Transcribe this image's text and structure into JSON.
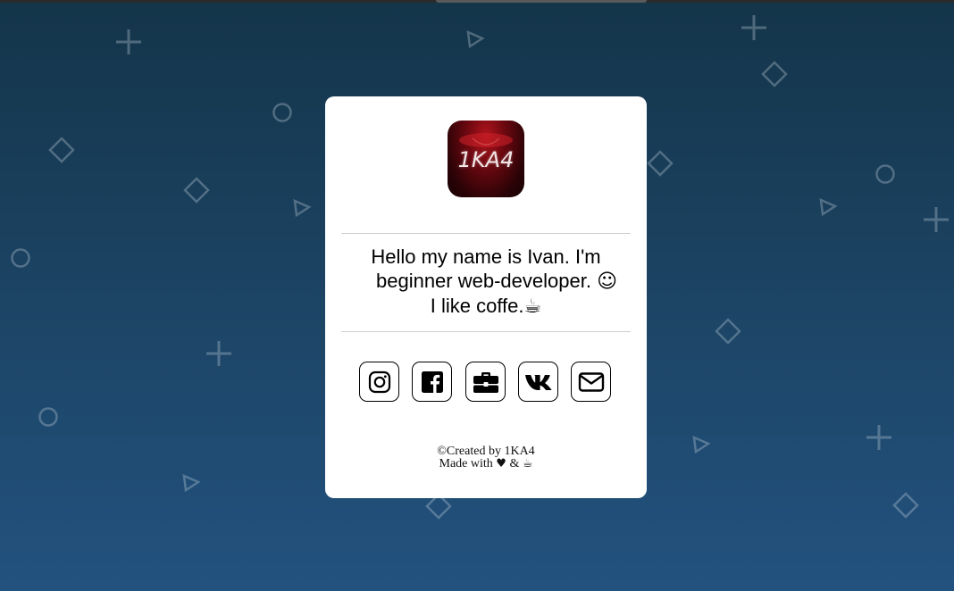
{
  "profile": {
    "logo_text": "1KA4",
    "bio_line1": "Hello my name is Ivan. I'm",
    "bio_line2": "beginner web-developer.",
    "bio_line2_emoji": "☺",
    "bio_line3": "I like coffe.",
    "bio_line3_emoji": "☕"
  },
  "socials": [
    {
      "name": "instagram",
      "icon": "instagram-icon"
    },
    {
      "name": "facebook",
      "icon": "facebook-icon"
    },
    {
      "name": "portfolio",
      "icon": "briefcase-icon"
    },
    {
      "name": "vk",
      "icon": "vk-icon"
    },
    {
      "name": "email",
      "icon": "envelope-icon"
    }
  ],
  "footer": {
    "copyright": "©Created by 1KA4",
    "made_with": "Made with",
    "heart": "♥",
    "amp": "&",
    "coffee": "☕"
  },
  "colors": {
    "background_top": "#14354a",
    "background_bottom": "#23527f",
    "card": "#ffffff",
    "shape_stroke": "#8aa0b3"
  }
}
